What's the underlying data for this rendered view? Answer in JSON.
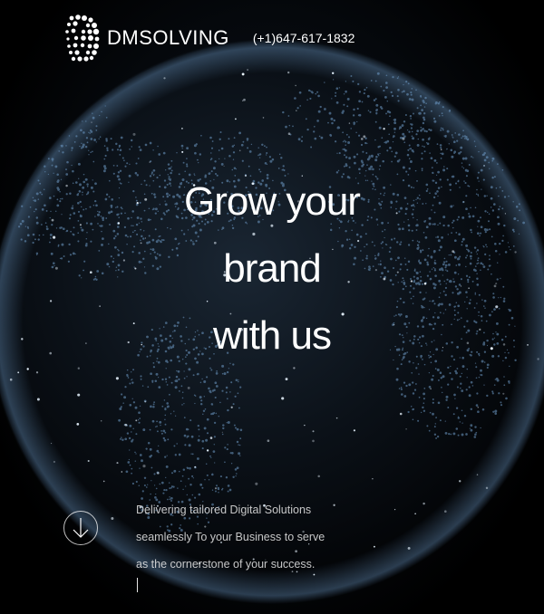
{
  "header": {
    "brand": "DMSOLVING",
    "phone": "(+1)647-617-1832"
  },
  "hero": {
    "headline_lines": [
      "Grow your",
      "brand",
      "with us"
    ],
    "tagline_lines": [
      "Delivering tailored Digital Solutions",
      "seamlessly To your Business to serve",
      "as the cornerstone of your success."
    ]
  },
  "icons": {
    "logo": "dotted-sphere-logo-icon",
    "scroll": "arrow-down-icon",
    "background": "digital-globe"
  },
  "colors": {
    "background": "#000000",
    "text": "#ffffff",
    "globe_dots": "#9fd0ff"
  }
}
